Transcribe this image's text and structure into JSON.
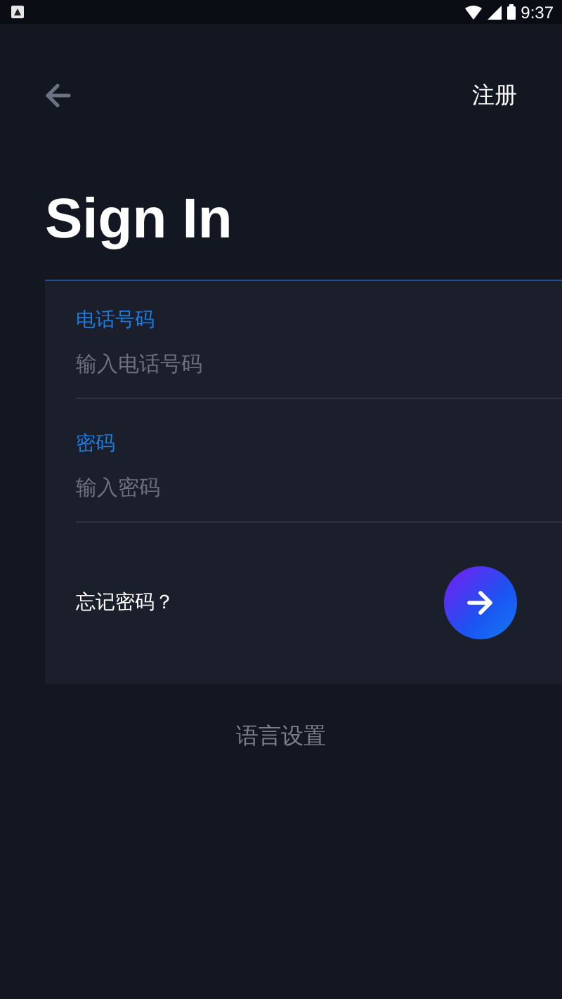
{
  "status_bar": {
    "time": "9:37"
  },
  "header": {
    "register_link": "注册"
  },
  "title": "Sign In",
  "form": {
    "fields": [
      {
        "label": "电话号码",
        "placeholder": "输入电话号码"
      },
      {
        "label": "密码",
        "placeholder": "输入密码"
      }
    ],
    "forgot_link": "忘记密码？"
  },
  "language_link": "语言设置"
}
